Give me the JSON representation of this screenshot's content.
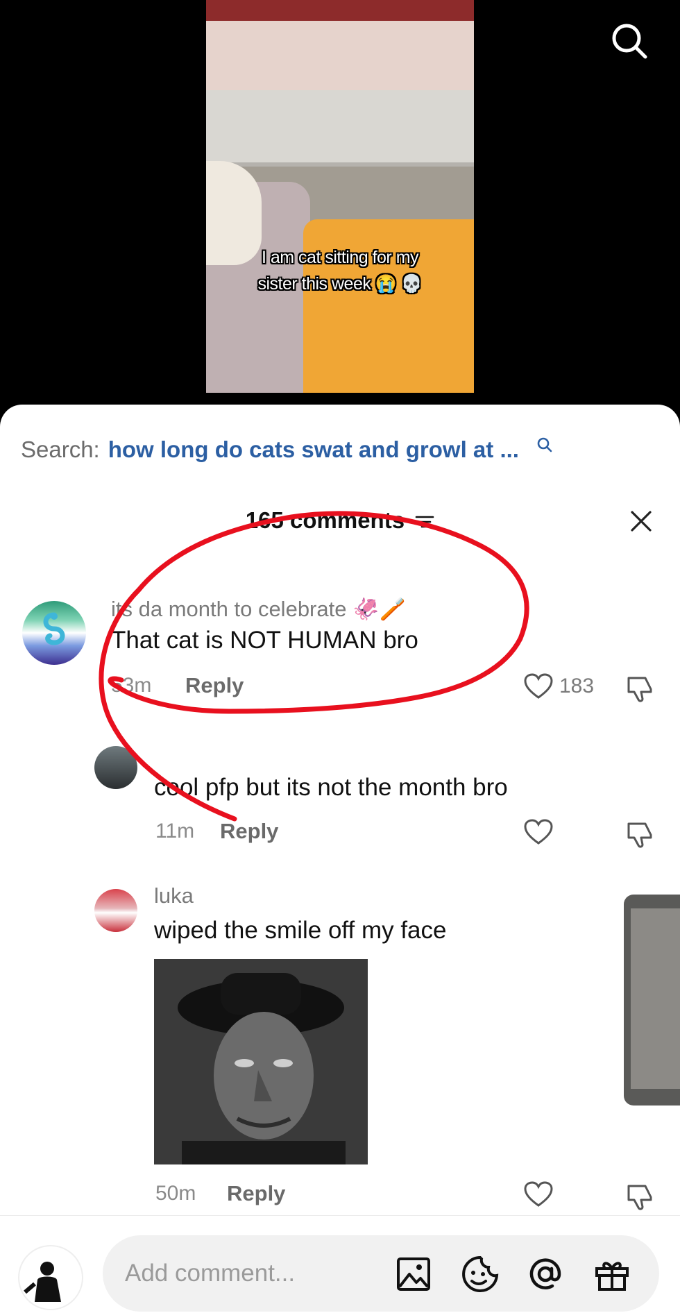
{
  "video": {
    "caption_line1": "I am cat sitting for my",
    "caption_line2": "sister this week 😭 💀",
    "search_icon": "search-icon"
  },
  "search": {
    "prefix": "Search:",
    "query": "how long do cats swat and growl at ...",
    "icon": "search-icon"
  },
  "comments_header": {
    "title": "165 comments",
    "sort_icon": "sort-filter-icon",
    "close_icon": "close-icon"
  },
  "comments": [
    {
      "username": "its da month to celebrate 🦑🪥",
      "text": "That cat is NOT HUMAN bro",
      "time": "53m",
      "reply": "Reply",
      "likes": "183"
    },
    {
      "username": "",
      "text": "cool pfp but its not the month bro",
      "time": "11m",
      "reply": "Reply",
      "likes": ""
    },
    {
      "username": "luka",
      "text": "wiped the smile off my face",
      "time": "50m",
      "reply": "Reply",
      "likes": ""
    }
  ],
  "composer": {
    "placeholder": "Add comment...",
    "tools": [
      "image-icon",
      "emoji-icon",
      "mention-icon",
      "gift-icon"
    ]
  },
  "colors": {
    "search_query": "#2c5fa3",
    "annotation": "#e8101e"
  }
}
